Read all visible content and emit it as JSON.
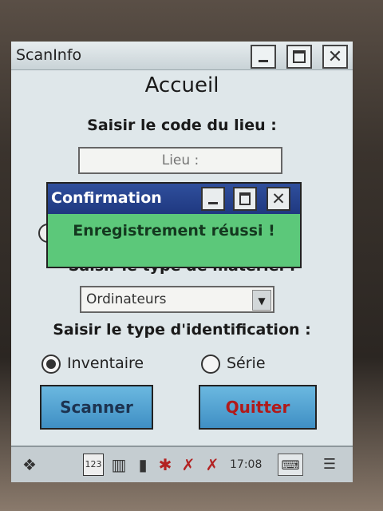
{
  "window": {
    "title": "ScanInfo",
    "min_icon": "minimize-icon",
    "max_icon": "maximize-icon",
    "close_icon": "close-icon",
    "close_glyph": "✕"
  },
  "page": {
    "heading": "Accueil",
    "lieu_label": "Saisir le code du lieu :",
    "lieu_placeholder": "Lieu :",
    "type_materiel_label": "Saisir le type de matériel :",
    "type_materiel_value": "Ordinateurs",
    "type_id_label": "Saisir le type d'identification :",
    "radio_inventaire": "Inventaire",
    "radio_serie": "Série",
    "btn_scanner": "Scanner",
    "btn_quitter": "Quitter"
  },
  "dialog": {
    "title": "Confirmation",
    "message": "Enregistrement réussi !",
    "close_glyph": "✕"
  },
  "taskbar": {
    "time": "17:08",
    "icons": [
      "start-icon",
      "calendar-icon",
      "barcode-icon",
      "battery-icon",
      "bluetooth-icon",
      "wifi-off-icon",
      "signal-off-icon",
      "keyboard-icon",
      "menu-icon"
    ],
    "calendar_text": "123"
  },
  "colors": {
    "dialog_title": "#2f4f9c",
    "dialog_body": "#5cc87a",
    "button": "#4fa0d0",
    "quit_text": "#b11a1a"
  }
}
